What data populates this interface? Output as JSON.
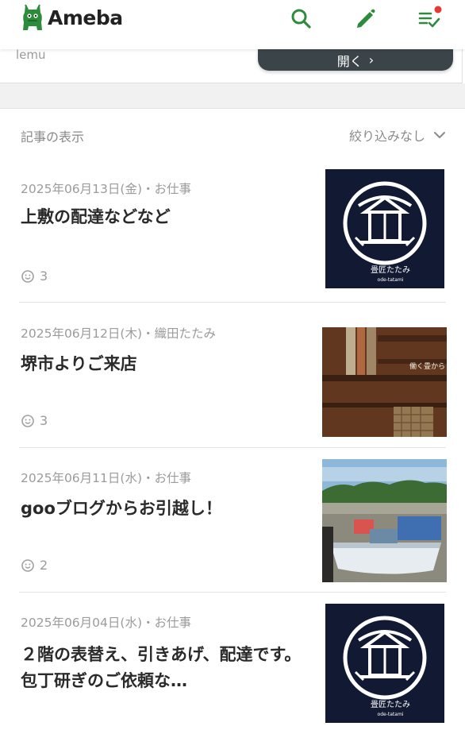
{
  "header": {
    "logo_text": "Ameba",
    "icons": [
      "search-icon",
      "pencil-icon",
      "checklist-icon"
    ],
    "brand_color": "#2d8c3c",
    "notification_dot_color": "#e53935"
  },
  "top_card": {
    "text": "lemu",
    "open_button_label": "開く",
    "open_button_arrow": "›"
  },
  "section": {
    "label": "記事の表示",
    "filter_label": "絞り込みなし"
  },
  "articles": [
    {
      "date": "2025年06月13日(金)",
      "category": "・お仕事",
      "title": "上敷の配達などなど",
      "likes": "3",
      "thumbnail": "logo-image",
      "thumb_caption": "畳匠たたみ",
      "thumb_sub": "ode-tatami"
    },
    {
      "date": "2025年06月12日(木)",
      "category": "・織田たたみ",
      "title": "堺市よりご来店",
      "likes": "3",
      "thumbnail": "wood-shelves-photo",
      "thumb_caption": "働く畳から 静かたたみ"
    },
    {
      "date": "2025年06月11日(水)",
      "category": "・お仕事",
      "title": "gooブログからお引越し！",
      "likes": "2",
      "thumbnail": "boats-photo"
    },
    {
      "date": "2025年06月04日(水)",
      "category": "・お仕事",
      "title": "２階の表替え、引きあげ、配達です。　包丁研ぎのご依頼な…",
      "thumbnail": "logo-image",
      "thumb_caption": "畳匠たたみ",
      "thumb_sub": "ode-tatami"
    }
  ]
}
